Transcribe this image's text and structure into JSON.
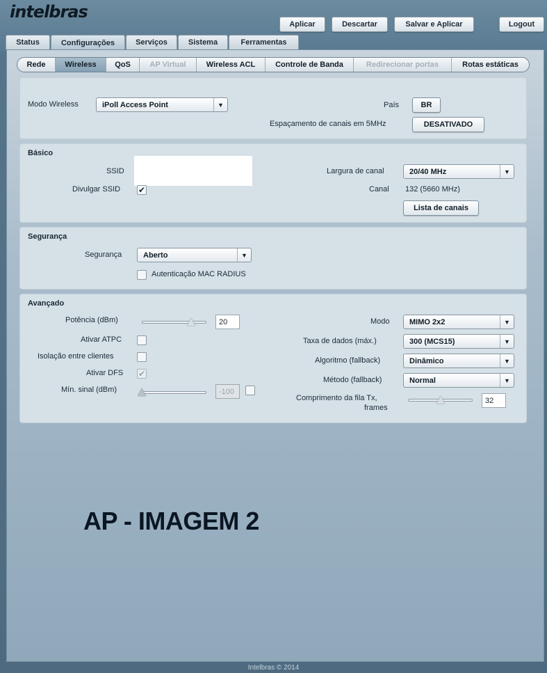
{
  "brand": {
    "logo": "intelbras"
  },
  "top_buttons": {
    "apply": "Aplicar",
    "discard": "Descartar",
    "save_apply": "Salvar e Aplicar",
    "logout": "Logout"
  },
  "main_tabs": [
    "Status",
    "Configurações",
    "Serviços",
    "Sistema",
    "Ferramentas"
  ],
  "main_tab_active": "Configurações",
  "sub_tabs": [
    "Rede",
    "Wireless",
    "QoS",
    "AP Virtual",
    "Wireless ACL",
    "Controle de Banda",
    "Redirecionar portas",
    "Rotas estáticas"
  ],
  "sub_tab_active": "Wireless",
  "sub_tabs_disabled": [
    "AP Virtual",
    "Redirecionar portas"
  ],
  "mode_panel": {
    "wireless_mode_label": "Modo Wireless",
    "wireless_mode_value": "iPoll Access Point",
    "country_label": "País",
    "country_value": "BR",
    "spacing_label": "Espaçamento de canais em 5MHz",
    "spacing_value": "DESATIVADO"
  },
  "basic": {
    "title": "Básico",
    "ssid_label": "SSID",
    "ssid_value": "",
    "broadcast_label": "Divulgar SSID",
    "broadcast_checked": true,
    "channel_width_label": "Largura de canal",
    "channel_width_value": "20/40 MHz",
    "channel_label": "Canal",
    "channel_value": "132 (5660 MHz)",
    "channel_list_button": "Lista de canais"
  },
  "security": {
    "title": "Segurança",
    "security_label": "Segurança",
    "security_value": "Aberto",
    "mac_radius_label": "Autenticação MAC RADIUS",
    "mac_radius_checked": false
  },
  "advanced": {
    "title": "Avançado",
    "power_label": "Potência (dBm)",
    "power_value": "20",
    "power_slider_fraction": 0.8,
    "atpc_label": "Ativar ATPC",
    "atpc_checked": false,
    "isolation_label": "Isolação entre clientes",
    "isolation_checked": false,
    "dfs_label": "Ativar DFS",
    "dfs_checked": true,
    "min_signal_label": "Mín. sinal (dBm)",
    "min_signal_value": "-100",
    "min_signal_slider_fraction": 0.0,
    "min_signal_enabled": false,
    "mode_label": "Modo",
    "mode_value": "MIMO 2x2",
    "rate_label": "Taxa de dados (máx.)",
    "rate_value": "300 (MCS15)",
    "algorithm_label": "Algoritmo (fallback)",
    "algorithm_value": "Dinâmico",
    "method_label": "Método (fallback)",
    "method_value": "Normal",
    "txqueue_label_1": "Comprimento da fila Tx,",
    "txqueue_label_2": "frames",
    "txqueue_value": "32",
    "txqueue_slider_fraction": 0.5
  },
  "overlay_caption": "AP - IMAGEM 2",
  "footer": "Intelbras © 2014",
  "icons": {
    "dropdown": "chevron-down-icon",
    "check": "checkmark-icon"
  }
}
